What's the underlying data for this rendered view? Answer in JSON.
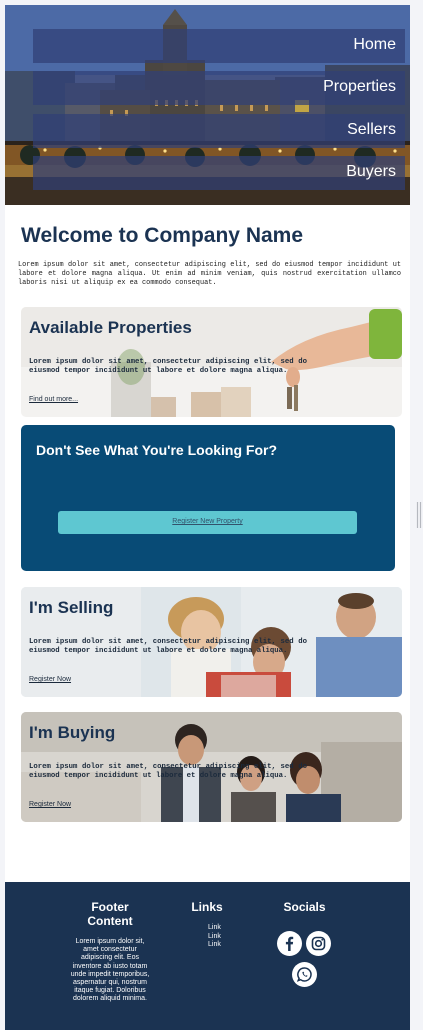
{
  "nav": {
    "items": [
      {
        "label": "Home"
      },
      {
        "label": "Properties"
      },
      {
        "label": "Sellers"
      },
      {
        "label": "Buyers"
      }
    ]
  },
  "welcome": {
    "title": "Welcome to Company Name",
    "text": "Lorem ipsum dolor sit amet, consectetur adipiscing elit, sed do eiusmod tempor incididunt ut labore et dolore magna aliqua. Ut enim ad minim veniam, quis nostrud exercitation ullamco laboris nisi ut aliquip ex ea commodo consequat."
  },
  "properties_card": {
    "title": "Available Properties",
    "text": "Lorem ipsum dolor sit amet, consectetur adipiscing elit, sed do eiusmod tempor incididunt ut labore et dolore magna aliqua.",
    "link": "Find out more..."
  },
  "cta": {
    "title": "Don't See What You're Looking For?",
    "button": "Register New Property"
  },
  "selling_card": {
    "title": "I'm Selling",
    "text": "Lorem ipsum dolor sit amet, consectetur adipiscing elit, sed do eiusmod tempor incididunt ut labore et dolore magna aliqua.",
    "link": "Register Now"
  },
  "buying_card": {
    "title": "I'm Buying",
    "text": "Lorem ipsum dolor sit amet, consectetur adipiscing elit, sed do eiusmod tempor incididunt ut labore et dolore magna aliqua.",
    "link": "Register Now"
  },
  "footer": {
    "content_title": "Footer Content",
    "content_text": "Lorem ipsum dolor sit, amet consectetur adipiscing elit. Eos inventore ab iusto totam unde impedit temporibus, aspernatur qui, nostrum itaque fugiat. Doloribus dolorem aliquid minima.",
    "links_title": "Links",
    "links": [
      "Link",
      "Link",
      "Link"
    ],
    "socials_title": "Socials",
    "socials": [
      "facebook-icon",
      "instagram-icon",
      "whatsapp-icon"
    ]
  },
  "colors": {
    "navy": "#1b3352",
    "cta_blue": "#084b76",
    "cta_button": "#5ec7d1",
    "nav_overlay": "#304076"
  }
}
